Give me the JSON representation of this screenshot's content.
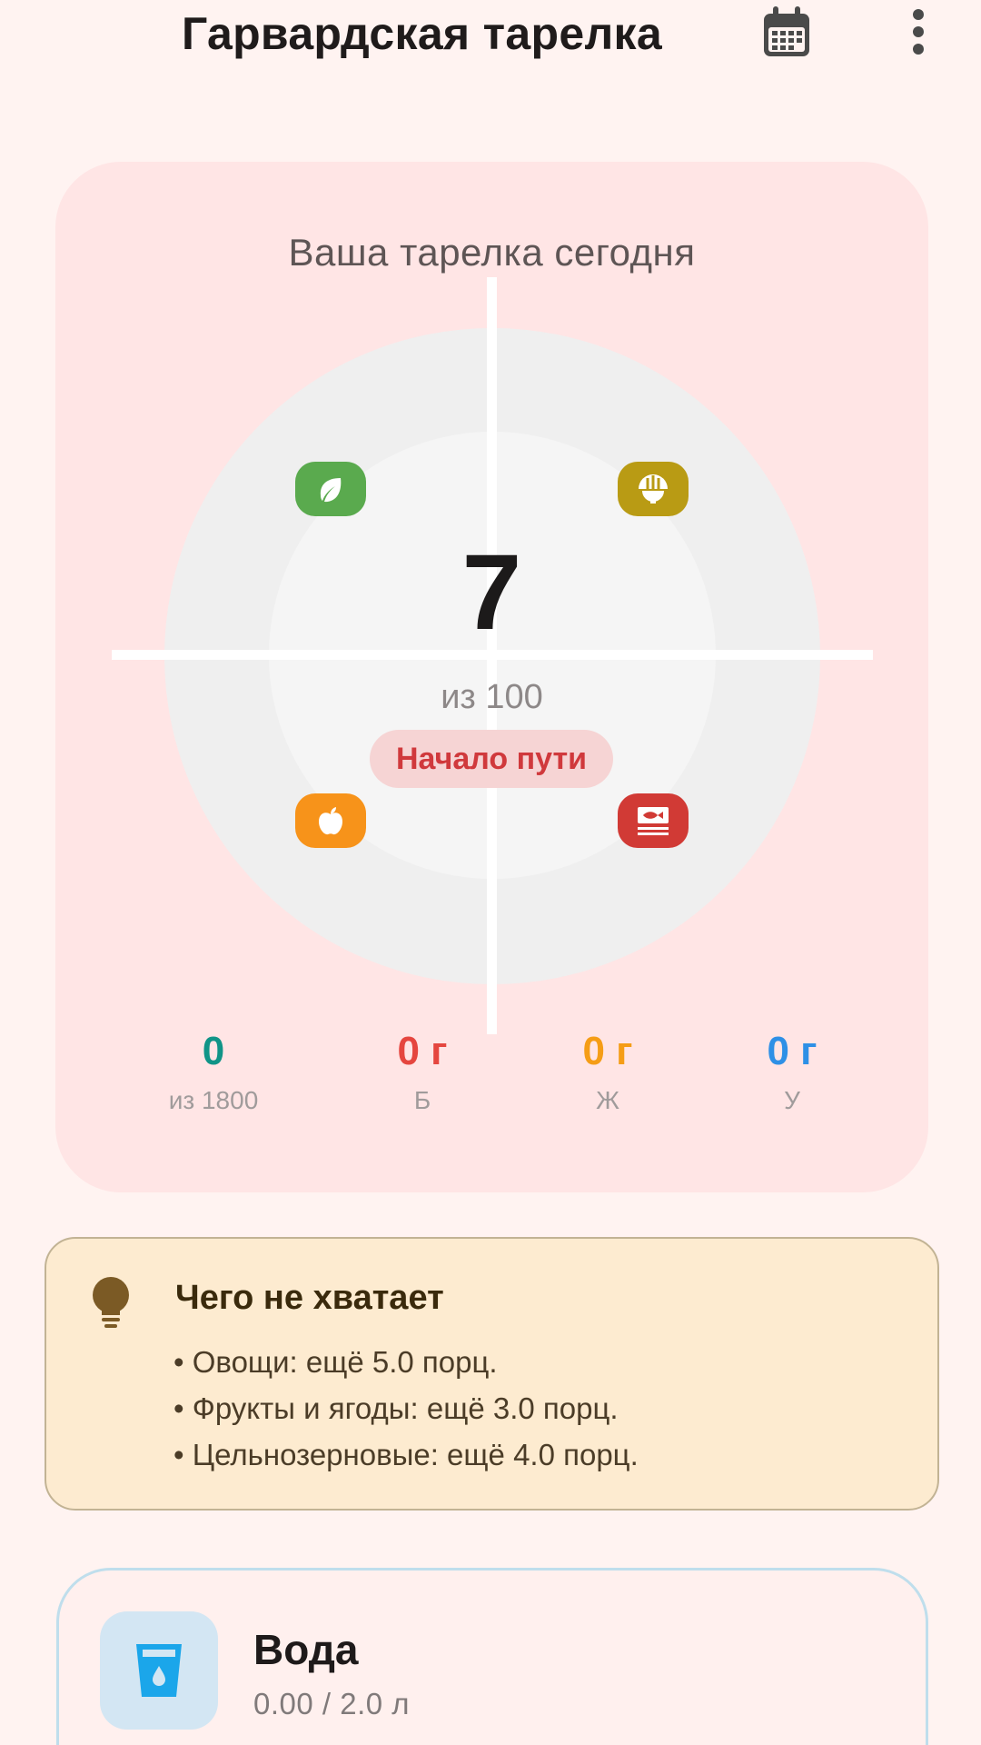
{
  "header": {
    "title": "Гарвардская тарелка",
    "calendar_icon": "calendar-icon",
    "more_icon": "more-vertical-icon"
  },
  "plate": {
    "title": "Ваша тарелка сегодня",
    "score": "7",
    "score_of": "из 100",
    "level": "Начало пути",
    "sections": [
      {
        "name": "vegetables",
        "icon": "leaf-icon",
        "color": "#5aaa4e"
      },
      {
        "name": "grains",
        "icon": "grain-bowl-icon",
        "color": "#b99b14"
      },
      {
        "name": "fruits",
        "icon": "apple-icon",
        "color": "#f7931a"
      },
      {
        "name": "protein",
        "icon": "fish-icon",
        "color": "#d13a35"
      }
    ],
    "stats": [
      {
        "value": "0",
        "label": "из 1800",
        "color": "#109487"
      },
      {
        "value": "0 г",
        "label": "Б",
        "color": "#e5463f"
      },
      {
        "value": "0 г",
        "label": "Ж",
        "color": "#f59d16"
      },
      {
        "value": "0 г",
        "label": "У",
        "color": "#2e90e6"
      }
    ]
  },
  "missing": {
    "icon": "lightbulb-icon",
    "title": "Чего не хватает",
    "items": [
      "Овощи: ещё 5.0 порц.",
      "Фрукты и ягоды: ещё 3.0 порц.",
      "Цельнозерновые: ещё 4.0 порц."
    ]
  },
  "water": {
    "icon": "water-glass-icon",
    "title": "Вода",
    "progress": "0.00 / 2.0 л"
  }
}
